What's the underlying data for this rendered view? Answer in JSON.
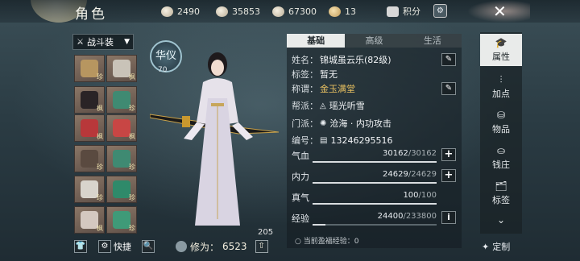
{
  "header": {
    "title": "角色",
    "resources": [
      {
        "icon": "coin-icon",
        "value": "2490"
      },
      {
        "icon": "silver-icon",
        "value": "35853"
      },
      {
        "icon": "ingot-icon",
        "value": "67300"
      },
      {
        "icon": "gold-icon",
        "value": "13"
      }
    ],
    "points_label": "积分",
    "close_label": "✕"
  },
  "equipment": {
    "set_label": "战斗装",
    "slots": [
      {
        "name": "slot-necklace",
        "tag": "珍",
        "color": "#b79660"
      },
      {
        "name": "slot-sword",
        "tag": "枫",
        "color": "#c9c3b8"
      },
      {
        "name": "slot-hair",
        "tag": "枫",
        "color": "#2a2426"
      },
      {
        "name": "slot-pendant",
        "tag": "珍",
        "color": "#3f8a72"
      },
      {
        "name": "slot-robe",
        "tag": "枫",
        "color": "#b8383a"
      },
      {
        "name": "slot-sleeve",
        "tag": "枫",
        "color": "#c84644"
      },
      {
        "name": "slot-belt",
        "tag": "珍",
        "color": "#5a4a40"
      },
      {
        "name": "slot-bracelet",
        "tag": "珍",
        "color": "#3f8a72"
      },
      {
        "name": "slot-skirt",
        "tag": "珍",
        "color": "#d8d4cc"
      },
      {
        "name": "slot-ring",
        "tag": "珍",
        "color": "#2f8a6a"
      },
      {
        "name": "slot-boots",
        "tag": "枫",
        "color": "#d4c8c0"
      },
      {
        "name": "slot-jade",
        "tag": "珍",
        "color": "#3f9a78"
      }
    ],
    "quick_label": "快捷"
  },
  "character": {
    "badge_text": "华仪",
    "badge_number": "70",
    "cultivation_label": "修为：",
    "cultivation_value": "6523",
    "pet_number": "205"
  },
  "info": {
    "tabs": [
      "基础",
      "高级",
      "生活"
    ],
    "name_label": "姓名：",
    "name_value": "锦城虽云乐(82级)",
    "tag_label": "标签：",
    "tag_value": "暂无",
    "title_label": "称谓：",
    "title_value": "金玉满堂",
    "guild_label": "帮派：",
    "guild_value": "瑶光听雪",
    "sect_label": "门派：",
    "sect_value": "沧海 · 内功攻击",
    "id_label": "编号：",
    "id_value": "13246295516",
    "stats": [
      {
        "label": "气血",
        "current": "30162",
        "max": "30162",
        "ratio": 1.0
      },
      {
        "label": "内力",
        "current": "24629",
        "max": "24629",
        "ratio": 1.0
      },
      {
        "label": "真气",
        "current": "100",
        "max": "100",
        "ratio": 1.0
      },
      {
        "label": "经验",
        "current": "24400",
        "max": "233800",
        "ratio": 0.104
      }
    ],
    "exp_hint": "当前盈福经验：0"
  },
  "sidebar": {
    "items": [
      {
        "label": "属性",
        "icon": "attribute-icon"
      },
      {
        "label": "加点",
        "icon": "sliders-icon"
      },
      {
        "label": "物品",
        "icon": "bag-icon"
      },
      {
        "label": "钱庄",
        "icon": "bank-icon"
      },
      {
        "label": "标签",
        "icon": "tag-icon"
      }
    ],
    "custom_label": "定制"
  }
}
